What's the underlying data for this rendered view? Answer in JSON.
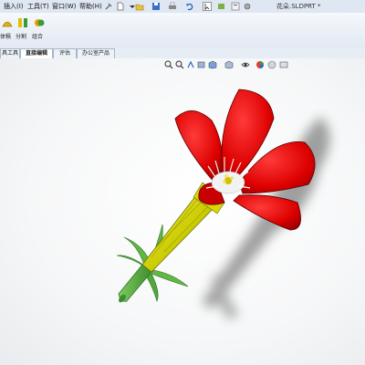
{
  "menubar": {
    "items": [
      {
        "label": "插入(I)"
      },
      {
        "label": "工具(T)"
      },
      {
        "label": "窗口(W)"
      },
      {
        "label": "帮助(H)"
      }
    ],
    "document_title": "花朵.SLDPRT *"
  },
  "ribbon": {
    "buttons": [
      {
        "label": "体積",
        "icon": "surface-body-icon"
      },
      {
        "label": "分割",
        "icon": "split-icon"
      },
      {
        "label": "组合",
        "icon": "combine-icon"
      }
    ]
  },
  "tabs": [
    {
      "label": "具工具",
      "active": false
    },
    {
      "label": "直接编辑",
      "active": true
    },
    {
      "label": "评估",
      "active": false
    },
    {
      "label": "办公室产品",
      "active": false
    }
  ],
  "model": {
    "petal_color": "#dd0000",
    "tube_color": "#c8c800",
    "stem_color": "#4fa83a",
    "leaf_color": "#5fb846"
  }
}
